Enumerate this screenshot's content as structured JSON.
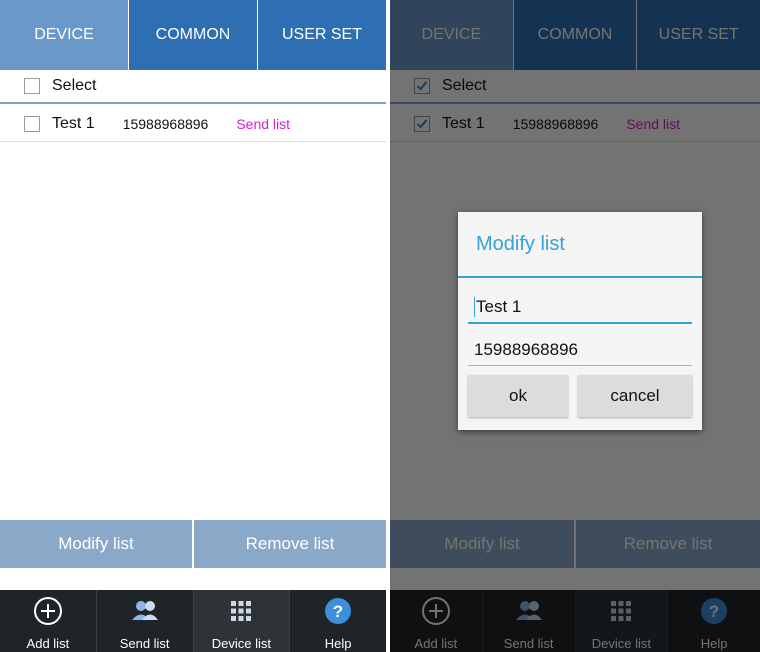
{
  "tabs": [
    "DEVICE",
    "COMMON",
    "USER SET"
  ],
  "select_label": "Select",
  "item": {
    "name": "Test 1",
    "phone": "15988968896",
    "send": "Send list"
  },
  "actions": {
    "modify": "Modify list",
    "remove": "Remove list"
  },
  "bottom_nav": {
    "add": "Add list",
    "send": "Send list",
    "device": "Device list",
    "help": "Help"
  },
  "dialog": {
    "title": "Modify list",
    "name_value": "Test 1",
    "phone_value": "15988968896",
    "ok": "ok",
    "cancel": "cancel"
  },
  "icons": [
    "add-circle-icon",
    "contacts-icon",
    "grid-icon",
    "help-icon",
    "check-icon"
  ],
  "colors": {
    "tab_bar": "#2e6fb3",
    "tab_active": "#6a98c9",
    "send_link": "#d420cf",
    "dialog_accent": "#33a3d6",
    "bottom_bar": "#1f2428"
  }
}
